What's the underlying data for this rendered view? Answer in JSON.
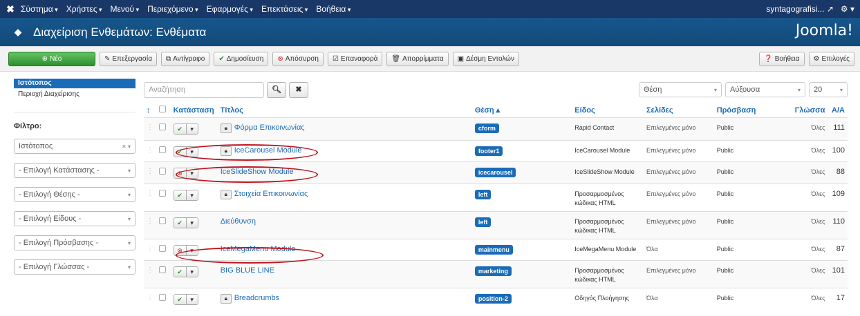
{
  "topnav": {
    "logo": "✖",
    "menu": [
      "Σύστημα",
      "Χρήστες",
      "Μενού",
      "Περιεχόμενο",
      "Εφαρμογές",
      "Επεκτάσεις",
      "Βοήθεια"
    ],
    "site": "syntagografisi...",
    "external_icon": "external-link-icon",
    "gear_icon": "gear-icon"
  },
  "header": {
    "title": "Διαχείριση Ενθεμάτων: Ενθέματα",
    "brand": "Joomla!"
  },
  "toolbar": {
    "new": "Νέο",
    "edit": "Επεξεργασία",
    "copy": "Αντίγραφο",
    "publish": "Δημοσίευση",
    "unpublish": "Απόσυρση",
    "checkin": "Επαναφορά",
    "trash": "Απορρίμματα",
    "batch": "Δέσμη Εντολών",
    "help": "Βοήθεια",
    "options": "Επιλογές"
  },
  "sidebar": {
    "active": "Ιστότοπος",
    "item": "Περιοχή Διαχείρισης",
    "filter_label": "Φίλτρο:",
    "filters": [
      "Ιστότοπος",
      "- Επιλογή Κατάστασης -",
      "- Επιλογή Θέσης -",
      "- Επιλογή Είδους -",
      "- Επιλογή Πρόσβασης -",
      "- Επιλογή Γλώσσας -"
    ]
  },
  "search": {
    "placeholder": "Αναζήτηση",
    "position_filter": "Θέση",
    "order": "Αύξουσα",
    "limit": "20"
  },
  "table": {
    "headers": {
      "sort": "↕",
      "status": "Κατάσταση",
      "title": "Τίτλος",
      "position": "Θέση ▴",
      "type": "Είδος",
      "pages": "Σελίδες",
      "access": "Πρόσβαση",
      "language": "Γλώσσα",
      "id": "Α/Α"
    },
    "rows": [
      {
        "title": "Φόρμα Επικοινωνίας",
        "locked": true,
        "published": true,
        "position": "cform",
        "type": "Rapid Contact",
        "type2": "",
        "pages": "Επιλεγμένες μόνο",
        "access": "Public",
        "language": "Όλες",
        "id": "111"
      },
      {
        "title": "IceCarousel Module",
        "locked": true,
        "published": true,
        "position": "footer1",
        "type": "IceCarousel Module",
        "type2": "",
        "pages": "Επιλεγμένες μόνο",
        "access": "Public",
        "language": "Όλες",
        "id": "100"
      },
      {
        "title": "IceSlideShow Module",
        "locked": false,
        "published": false,
        "position": "icecarousel",
        "type": "IceSlideShow Module",
        "type2": "",
        "pages": "Επιλεγμένες μόνο",
        "access": "Public",
        "language": "Όλες",
        "id": "88"
      },
      {
        "title": "Στοιχεία Επικοινωνίας",
        "locked": true,
        "published": true,
        "position": "left",
        "type": "Προσαρμοσμένος",
        "type2": "κώδικας HTML",
        "pages": "Επιλεγμένες μόνο",
        "access": "Public",
        "language": "Όλες",
        "id": "109"
      },
      {
        "title": "Διεύθυνση",
        "locked": false,
        "published": true,
        "position": "left",
        "type": "Προσαρμοσμένος",
        "type2": "κώδικας HTML",
        "pages": "Επιλεγμένες μόνο",
        "access": "Public",
        "language": "Όλες",
        "id": "110"
      },
      {
        "title": "IceMegaMenu Module",
        "locked": false,
        "published": false,
        "position": "mainmenu",
        "type": "IceMegaMenu Module",
        "type2": "",
        "pages": "Όλα",
        "access": "Public",
        "language": "Όλες",
        "id": "87"
      },
      {
        "title": "BIG BLUE LINE",
        "locked": false,
        "published": true,
        "position": "marketing",
        "type": "Προσαρμοσμένος",
        "type2": "κώδικας HTML",
        "pages": "Επιλεγμένες μόνο",
        "access": "Public",
        "language": "Όλες",
        "id": "101"
      },
      {
        "title": "Breadcrumbs",
        "locked": true,
        "published": true,
        "position": "position-2",
        "type": "Οδηγός Πλοήγησης",
        "type2": "",
        "pages": "Όλα",
        "access": "Public",
        "language": "Όλες",
        "id": "17"
      }
    ]
  },
  "colors": {
    "nav": "#1a3867",
    "header": "#17568c",
    "accent": "#1b6cb8",
    "annotation": "#c0141e"
  }
}
